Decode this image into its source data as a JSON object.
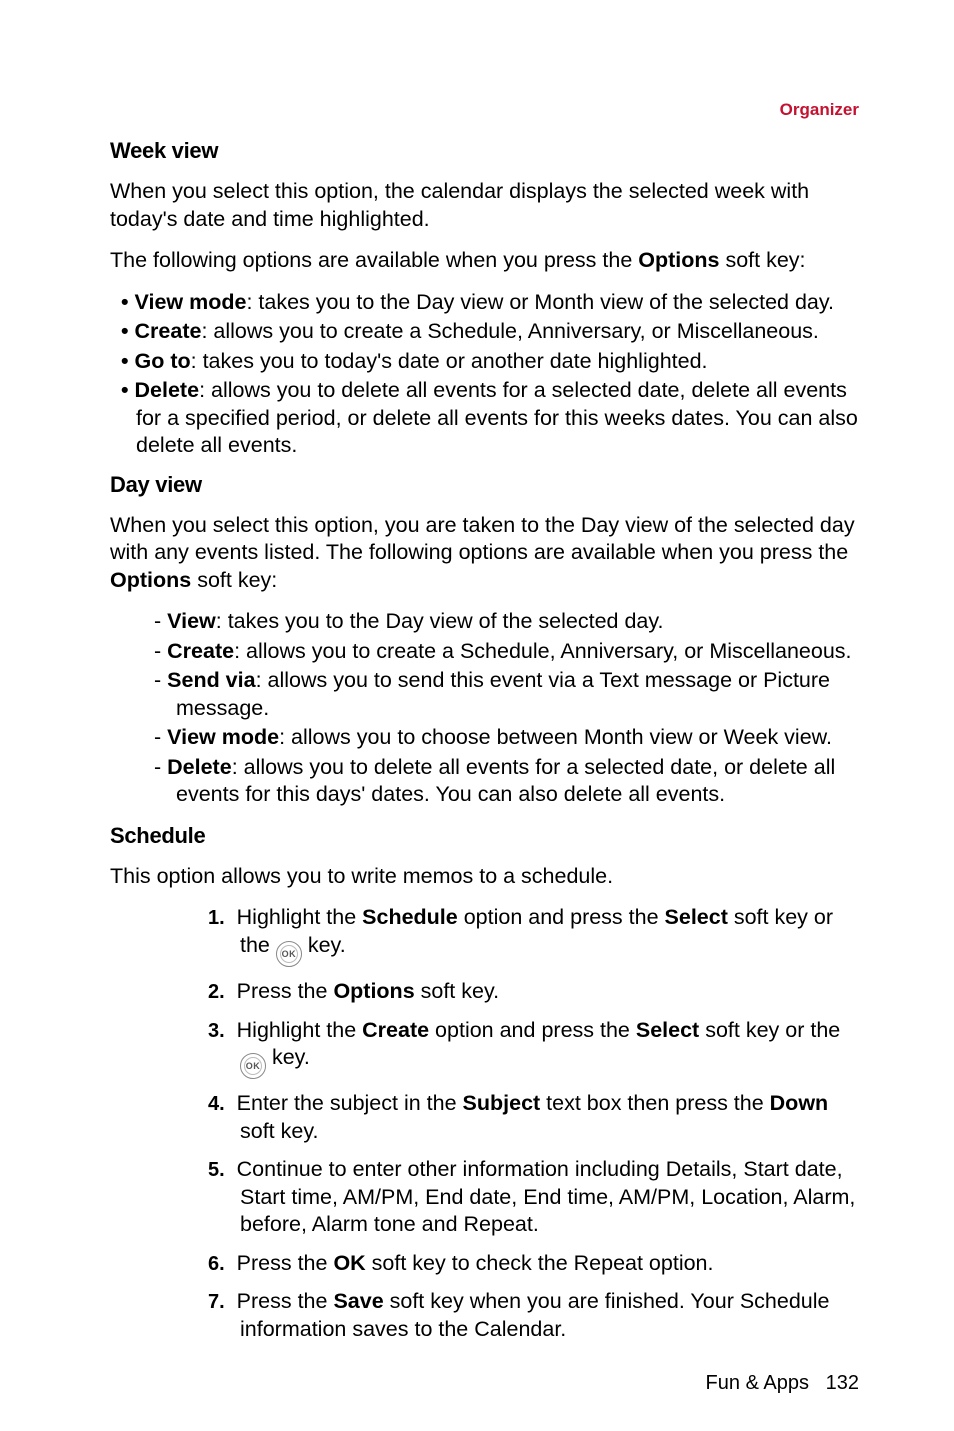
{
  "header": {
    "section": "Organizer"
  },
  "week": {
    "title": "Week view",
    "p1": "When you select this option, the calendar displays the selected week with today's date and time highlighted.",
    "p2_pre": "The following options are available when you press the ",
    "p2_bold": "Options",
    "p2_post": " soft key:",
    "items": [
      {
        "term": "View mode",
        "rest": ": takes you to the Day view or Month view of the selected day."
      },
      {
        "term": "Create",
        "rest": ": allows you to create a Schedule, Anniversary, or Miscellaneous."
      },
      {
        "term": "Go to",
        "rest": ": takes you to today's date or another date highlighted."
      },
      {
        "term": "Delete",
        "rest": ": allows you to delete all events for a selected date, delete all events for a specified period, or delete all events for this weeks dates. You can also delete all events."
      }
    ]
  },
  "day": {
    "title": "Day view",
    "p1_pre": "When you select this option, you are taken to the Day view of the selected day with any events listed. The following options are available when you press the ",
    "p1_bold": "Options",
    "p1_post": " soft key:",
    "items": [
      {
        "term": "View",
        "rest": ": takes you to the Day view of the selected day."
      },
      {
        "term": "Create",
        "rest": ": allows you to create a Schedule, Anniversary, or Miscellaneous."
      },
      {
        "term": "Send via",
        "rest": ": allows you to send this event via a Text message or Picture message."
      },
      {
        "term": "View mode",
        "rest": ": allows you to choose between Month view or Week view."
      },
      {
        "term": "Delete",
        "rest": ": allows you to delete all events for a selected date, or delete all events for this days' dates. You can also delete all events."
      }
    ]
  },
  "schedule": {
    "title": "Schedule",
    "p1": "This option allows you to write memos to a schedule.",
    "steps_nums": [
      "1.",
      "2.",
      "3.",
      "4.",
      "5.",
      "6.",
      "7."
    ],
    "step1": {
      "a": "Highlight the ",
      "b": "Schedule",
      "c": " option and press the ",
      "d": "Select",
      "e": " soft key or the ",
      "f": " key."
    },
    "step2": {
      "a": "Press the ",
      "b": "Options",
      "c": " soft key."
    },
    "step3": {
      "a": "Highlight the ",
      "b": "Create",
      "c": " option and press the ",
      "d": "Select",
      "e": " soft key or the ",
      "f": " key."
    },
    "step4": {
      "a": "Enter the subject in the ",
      "b": "Subject",
      "c": " text box then press the ",
      "d": "Down",
      "e": " soft key."
    },
    "step5": "Continue to enter other information including Details, Start date, Start time, AM/PM, End date, End time, AM/PM, Location, Alarm, before, Alarm tone and Repeat.",
    "step6": {
      "a": "Press the ",
      "b": "OK",
      "c": " soft key to check the Repeat option."
    },
    "step7": {
      "a": "Press the ",
      "b": "Save",
      "c": " soft key when you are finished. Your Schedule information saves to the Calendar."
    }
  },
  "footer": {
    "label": "Fun & Apps",
    "page": "132"
  },
  "ok_label": "OK"
}
